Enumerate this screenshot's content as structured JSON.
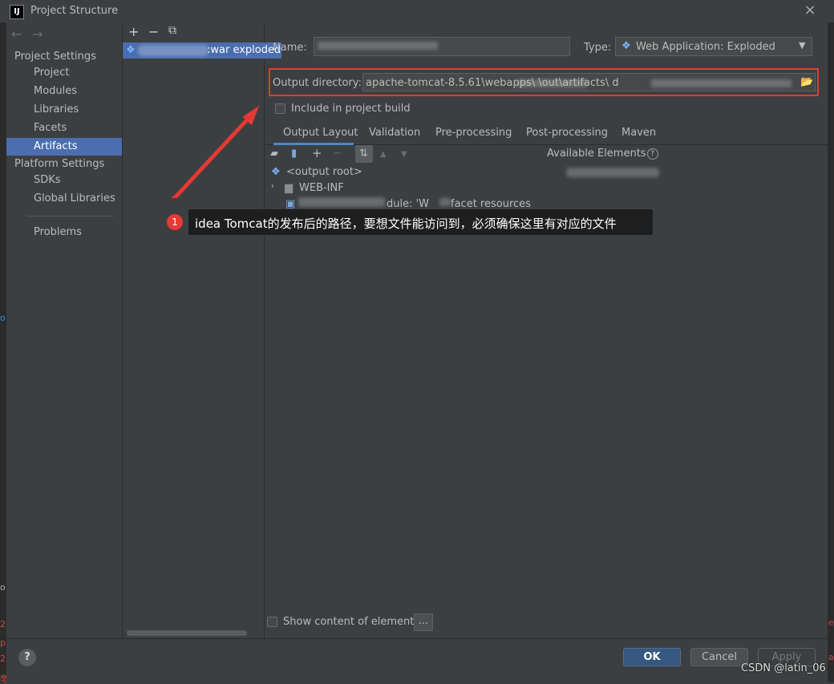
{
  "window": {
    "title": "Project Structure",
    "app_icon_text": "IJ"
  },
  "nav": {
    "back_icon": "arrow-left-icon",
    "forward_icon": "arrow-right-icon",
    "groups": [
      {
        "label": "Project Settings",
        "items": [
          "Project",
          "Modules",
          "Libraries",
          "Facets",
          "Artifacts"
        ]
      },
      {
        "label": "Platform Settings",
        "items": [
          "SDKs",
          "Global Libraries"
        ]
      }
    ],
    "problems": "Problems",
    "selected": "Artifacts"
  },
  "artifacts": {
    "toolbar": [
      "+",
      "−",
      "⧉"
    ],
    "item_label": ":war exploded"
  },
  "form": {
    "name_label": "Name:",
    "type_label": "Type:",
    "type_value": "Web Application: Exploded",
    "output_label": "Output directory:",
    "output_value": "apache-tomcat-8.5.61\\webapps\\                                      \\out\\artifacts\\                                                    d",
    "include_label": "Include in project build"
  },
  "tabs": [
    "Output Layout",
    "Validation",
    "Pre-processing",
    "Post-processing",
    "Maven"
  ],
  "layout": {
    "available_label": "Available Elements",
    "tree": [
      "<output root>",
      "WEB-INF",
      "dule: 'W",
      "facet resources"
    ]
  },
  "bottom": {
    "show_content_label": "Show content of elements",
    "dots": "..."
  },
  "footer": {
    "help": "?",
    "ok": "OK",
    "cancel": "Cancel",
    "apply": "Apply",
    "watermark": "CSDN @latin_06"
  },
  "annotation": {
    "number": "1",
    "text": "idea Tomcat的发布后的路径，要想文件能访问到，必须确保这里有对应的文件"
  },
  "colors": {
    "accent": "#4b6eaf",
    "highlight_red": "#e53935",
    "bg": "#3c3f41"
  }
}
